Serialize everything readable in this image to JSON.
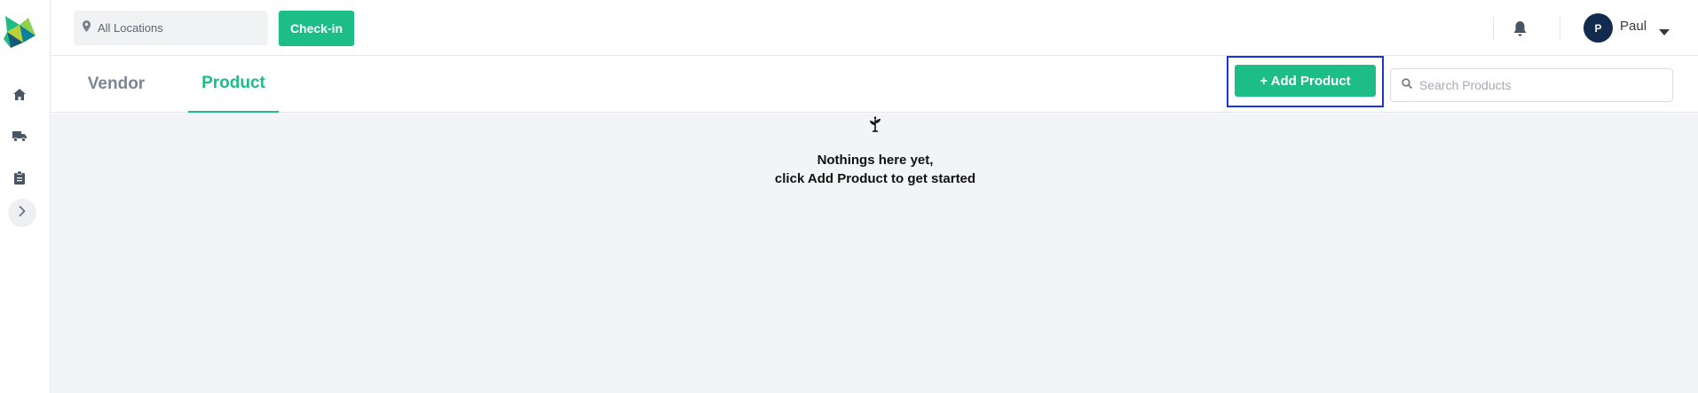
{
  "sidebar": {
    "logo": "app-logo",
    "items": [
      {
        "icon": "home-icon"
      },
      {
        "icon": "truck-icon"
      },
      {
        "icon": "clipboard-icon"
      }
    ],
    "expand_icon": "chevron-right-icon"
  },
  "topbar": {
    "location": {
      "label": "All Locations",
      "icon": "map-pin-icon"
    },
    "checkin_label": "Check-in",
    "notification_icon": "bell-icon",
    "user": {
      "initial": "P",
      "name": "Paul"
    }
  },
  "tabs": [
    {
      "label": "Vendor",
      "active": false
    },
    {
      "label": "Product",
      "active": true
    }
  ],
  "actions": {
    "add_product_label": "+ Add Product",
    "search_placeholder": "Search Products"
  },
  "empty_state": {
    "icon": "sprout-icon",
    "line1": "Nothings here yet,",
    "line2": "click Add Product to get started"
  },
  "colors": {
    "accent": "#1cbd87",
    "highlight": "#1a33e0",
    "avatar_bg": "#112a4e",
    "content_bg": "#f2f4f8"
  }
}
